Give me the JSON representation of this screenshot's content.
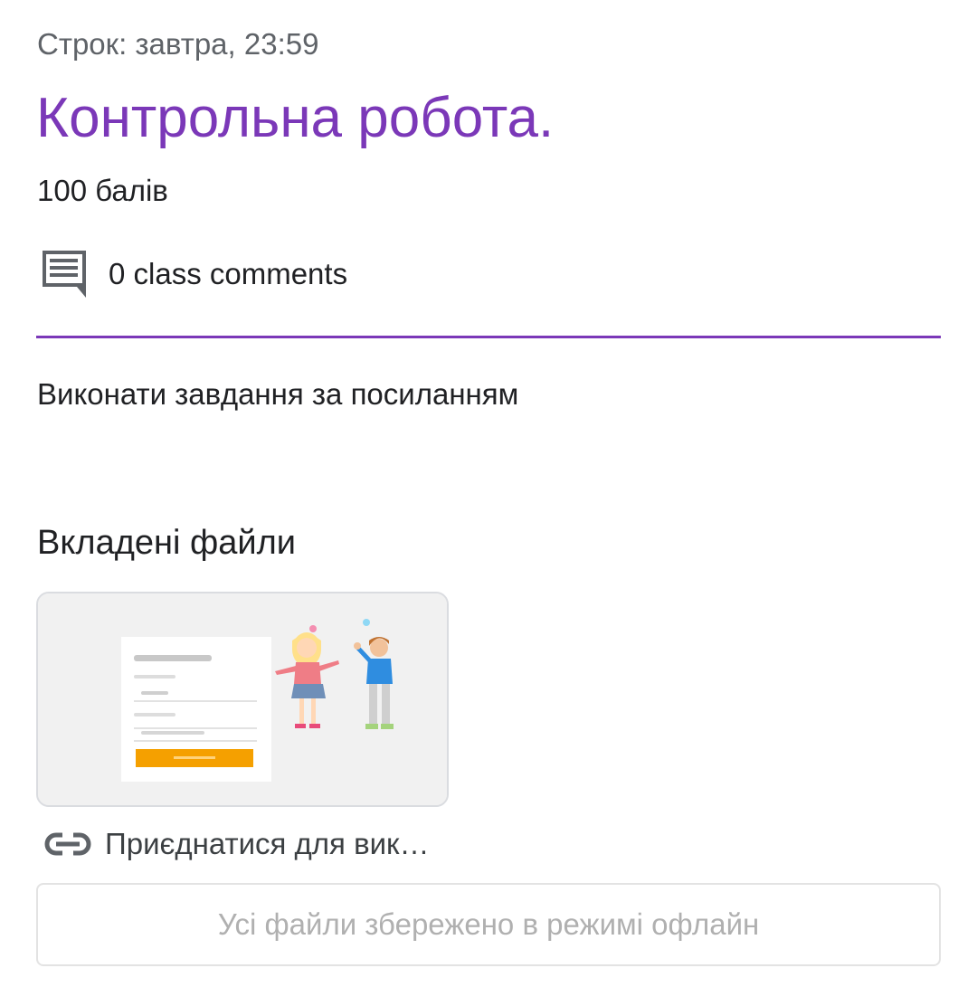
{
  "assignment": {
    "due": "Строк: завтра, 23:59",
    "title": "Контрольна робота.",
    "points": "100 балів",
    "comments_label": "0 class comments",
    "instructions": "Виконати завдання за посиланням"
  },
  "attachments": {
    "heading": "Вкладені файли",
    "items": [
      {
        "label": "Приєднатися для вик…",
        "icon": "link-icon"
      }
    ]
  },
  "offline_status": "Усі файли збережено в режимі офлайн",
  "colors": {
    "accent": "#7b38b8",
    "text": "#202124",
    "secondary_text": "#5f6368",
    "muted_text": "#b0b0b0",
    "thumbnail_button": "#f5a000"
  },
  "icons": {
    "comments": "comment-icon",
    "attachment": "link-icon"
  }
}
